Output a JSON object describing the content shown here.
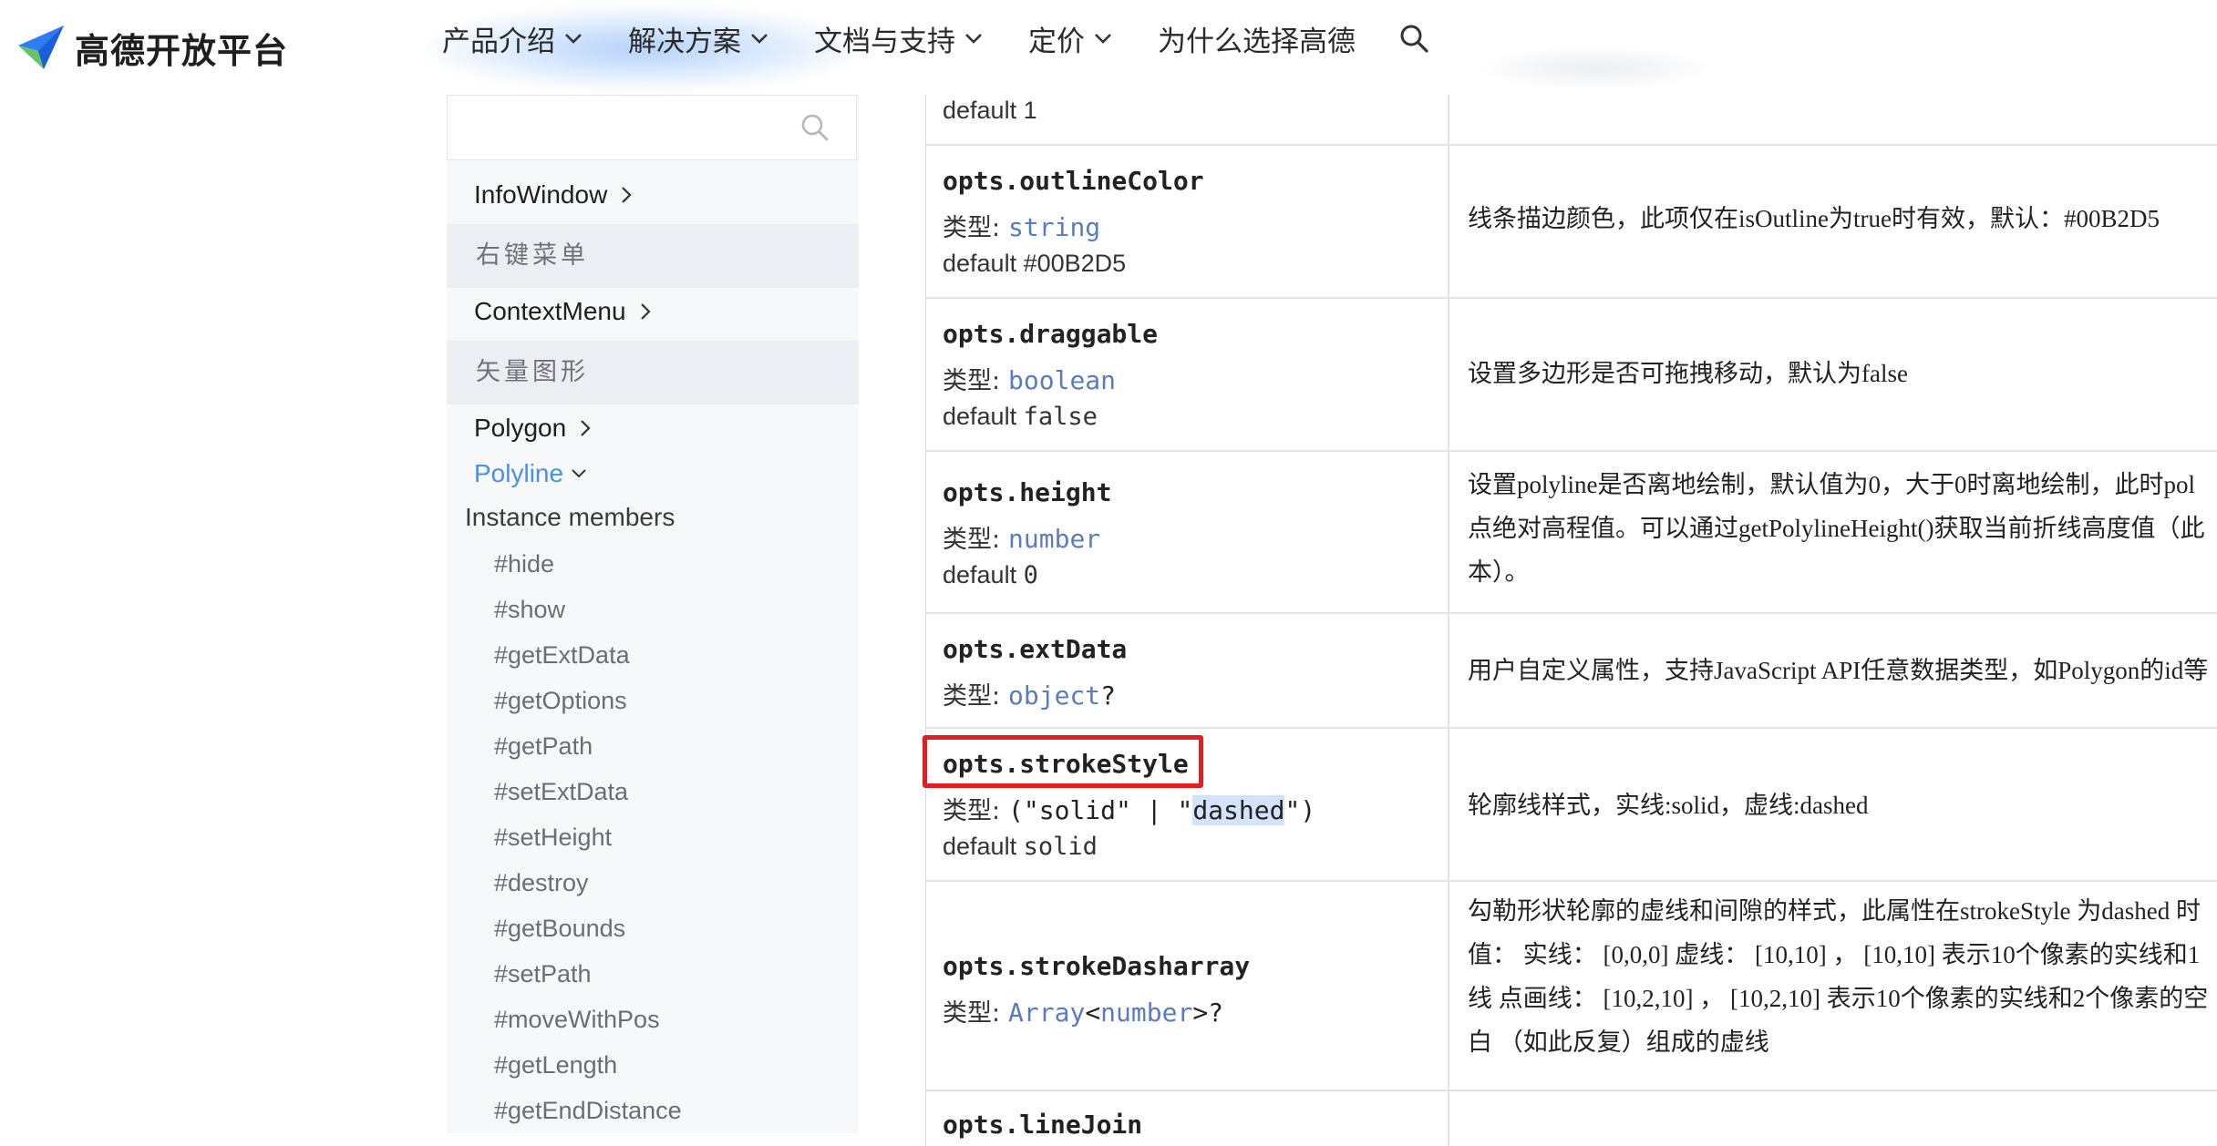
{
  "header": {
    "logo_text": "高德开放平台",
    "nav": [
      {
        "label": "产品介绍"
      },
      {
        "label": "解决方案"
      },
      {
        "label": "文档与支持"
      },
      {
        "label": "定价"
      },
      {
        "label": "为什么选择高德"
      }
    ]
  },
  "sidebar": {
    "search": {
      "value": "",
      "placeholder": ""
    },
    "infowindow": "InfoWindow",
    "group_context": "右键菜单",
    "contextmenu": "ContextMenu",
    "group_vector": "矢量图形",
    "polygon": "Polygon",
    "polyline": "Polyline",
    "instance_members": "Instance members",
    "members": [
      "#hide",
      "#show",
      "#getExtData",
      "#getOptions",
      "#getPath",
      "#setExtData",
      "#setHeight",
      "#destroy",
      "#getBounds",
      "#setPath",
      "#moveWithPos",
      "#getLength",
      "#getEndDistance"
    ]
  },
  "table": {
    "type_label": "类型:",
    "default_label": "default",
    "top_default_value": "1",
    "rows": [
      {
        "name": "opts.outlineColor",
        "type": "string",
        "default": "#00B2D5",
        "desc": [
          "线条描边颜色，此项仅在isOutline为true时有效，默认：#00B2D5"
        ]
      },
      {
        "name": "opts.draggable",
        "type": "boolean",
        "default": "false",
        "desc": [
          "设置多边形是否可拖拽移动，默认为false"
        ]
      },
      {
        "name": "opts.height",
        "type": "number",
        "default": "0",
        "desc": [
          "设置polyline是否离地绘制，默认值为0，大于0时离地绘制，此时pol",
          "点绝对高程值。可以通过getPolylineHeight()获取当前折线高度值（此",
          "本）。"
        ]
      },
      {
        "name": "opts.extData",
        "type": "object",
        "type_suffix": "?",
        "desc": [
          "用户自定义属性，支持JavaScript API任意数据类型，如Polygon的id等"
        ]
      },
      {
        "name": "opts.strokeStyle",
        "type_open": "(\"solid\" | \"",
        "type_hl": "dashed",
        "type_close": "\")",
        "default": "solid",
        "desc": [
          "轮廓线样式，实线:solid，虚线:dashed"
        ]
      },
      {
        "name": "opts.strokeDasharray",
        "type": "Array",
        "type_lt": "<",
        "type_inner": "number",
        "type_gt": ">?",
        "desc": [
          "勾勒形状轮廓的虚线和间隙的样式，此属性在strokeStyle 为dashed 时",
          "值： 实线： [0,0,0] 虚线： [10,10] ， [10,10] 表示10个像素的实线和1",
          "线 点画线： [10,2,10] ， [10,2,10] 表示10个像素的实线和2个像素的空",
          "白 （如此反复）组成的虚线"
        ]
      },
      {
        "name": "opts.lineJoin"
      }
    ]
  },
  "colors": {
    "accent": "#4a90e2",
    "type_blue": "#5b7bc0",
    "highlight_box": "#e02020"
  }
}
